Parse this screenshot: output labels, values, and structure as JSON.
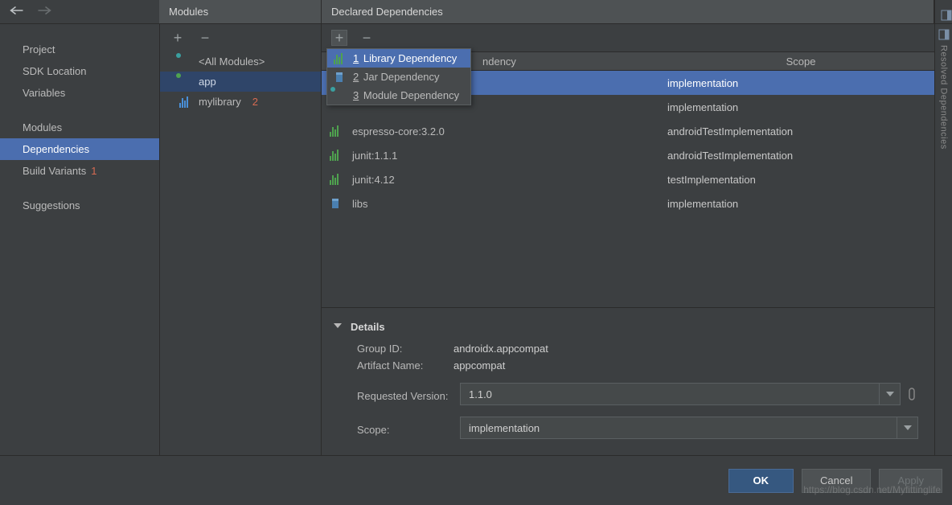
{
  "panels": {
    "modules": "Modules",
    "declared": "Declared Dependencies",
    "resolved": "Resolved Dependencies"
  },
  "sidebar": {
    "items": [
      "Project",
      "SDK Location",
      "Variables"
    ],
    "items2": [
      "Modules",
      "Dependencies",
      "Build Variants"
    ],
    "items3": [
      "Suggestions"
    ],
    "selected": "Dependencies",
    "anno1": "1"
  },
  "modules": {
    "items": [
      {
        "label": "<All Modules>",
        "icon": "folder"
      },
      {
        "label": "app",
        "icon": "folder-green",
        "selected": true
      },
      {
        "label": "mylibrary",
        "icon": "bars-blue"
      }
    ],
    "anno2": "2"
  },
  "dropdown": {
    "items": [
      {
        "n": "1",
        "label": "Library Dependency",
        "sel": true
      },
      {
        "n": "2",
        "label": "Jar Dependency"
      },
      {
        "n": "3",
        "label": "Module Dependency"
      }
    ]
  },
  "deps": {
    "header": {
      "name": "ndency",
      "scope": "Scope"
    },
    "rows": [
      {
        "name": "",
        "scope": "implementation",
        "sel": true
      },
      {
        "name": "",
        "scope": "implementation"
      },
      {
        "name": "espresso-core:3.2.0",
        "scope": "androidTestImplementation"
      },
      {
        "name": "junit:1.1.1",
        "scope": "androidTestImplementation"
      },
      {
        "name": "junit:4.12",
        "scope": "testImplementation"
      },
      {
        "name": "libs",
        "scope": "implementation",
        "icon": "blue"
      }
    ]
  },
  "details": {
    "title": "Details",
    "group_id_label": "Group ID:",
    "group_id": "androidx.appcompat",
    "artifact_label": "Artifact Name:",
    "artifact": "appcompat",
    "version_label": "Requested Version:",
    "version": "1.1.0",
    "scope_label": "Scope:",
    "scope": "implementation"
  },
  "footer": {
    "ok": "OK",
    "cancel": "Cancel",
    "apply": "Apply"
  },
  "watermark": "https://blog.csdn.net/Myfittinglife"
}
